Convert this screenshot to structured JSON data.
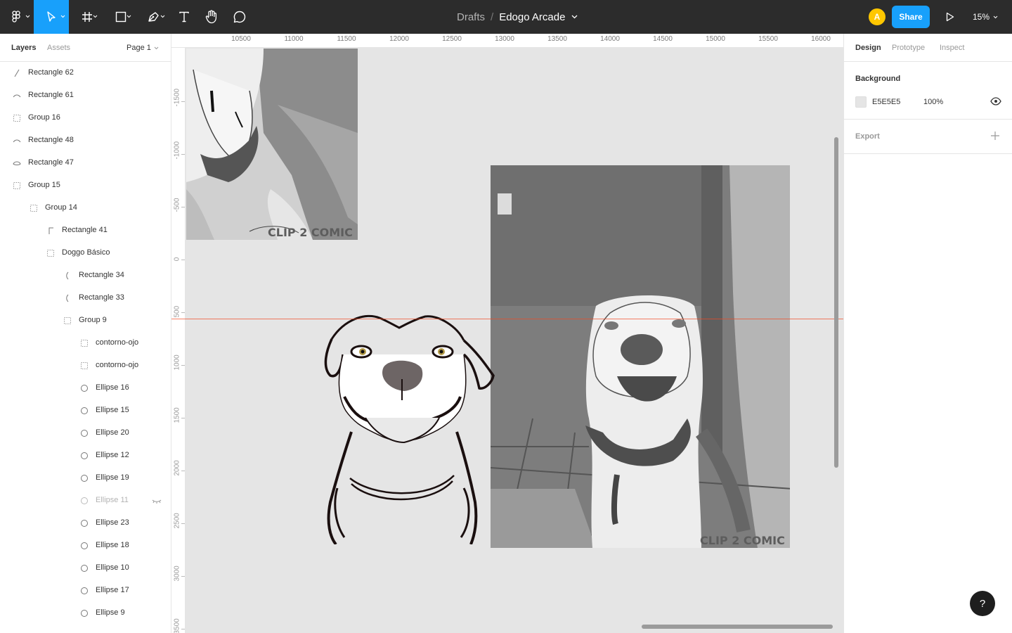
{
  "toolbar": {
    "tools": [
      {
        "icon": "figma-menu-icon"
      },
      {
        "icon": "move-tool-icon",
        "active": true
      },
      {
        "icon": "frame-tool-icon"
      },
      {
        "icon": "rectangle-tool-icon"
      },
      {
        "icon": "pen-tool-icon"
      },
      {
        "icon": "text-tool-icon"
      },
      {
        "icon": "hand-tool-icon"
      },
      {
        "icon": "comment-tool-icon"
      }
    ],
    "breadcrumb": "Drafts",
    "separator": "/",
    "file_name": "Edogo Arcade",
    "avatar_initial": "A",
    "share_label": "Share",
    "zoom": "15%",
    "accent_color": "#18a0fb"
  },
  "left_panel": {
    "tabs": [
      "Layers",
      "Assets"
    ],
    "page": "Page 1",
    "layers": [
      {
        "name": "Rectangle 62",
        "icon": "vector-line-icon",
        "depth": 0
      },
      {
        "name": "Rectangle 61",
        "icon": "vector-curve-icon",
        "depth": 0
      },
      {
        "name": "Group 16",
        "icon": "group-icon",
        "depth": 0
      },
      {
        "name": "Rectangle 48",
        "icon": "vector-curve-icon",
        "depth": 0
      },
      {
        "name": "Rectangle 47",
        "icon": "vector-shape-icon",
        "depth": 0
      },
      {
        "name": "Group 15",
        "icon": "group-icon",
        "depth": 0
      },
      {
        "name": "Group 14",
        "icon": "group-icon",
        "depth": 1
      },
      {
        "name": "Rectangle 41",
        "icon": "vector-corner-icon",
        "depth": 2
      },
      {
        "name": "Doggo Básico",
        "icon": "group-icon",
        "depth": 2
      },
      {
        "name": "Rectangle 34",
        "icon": "vector-paren-icon",
        "depth": 3
      },
      {
        "name": "Rectangle 33",
        "icon": "vector-paren-icon",
        "depth": 3
      },
      {
        "name": "Group 9",
        "icon": "group-icon",
        "depth": 3
      },
      {
        "name": "contorno-ojo",
        "icon": "group-icon",
        "depth": 4
      },
      {
        "name": "contorno-ojo",
        "icon": "group-icon",
        "depth": 4
      },
      {
        "name": "Ellipse 16",
        "icon": "ellipse-icon",
        "depth": 4
      },
      {
        "name": "Ellipse 15",
        "icon": "ellipse-icon",
        "depth": 4
      },
      {
        "name": "Ellipse 20",
        "icon": "ellipse-icon",
        "depth": 4
      },
      {
        "name": "Ellipse 12",
        "icon": "ellipse-icon",
        "depth": 4
      },
      {
        "name": "Ellipse 19",
        "icon": "ellipse-icon",
        "depth": 4
      },
      {
        "name": "Ellipse 11",
        "icon": "ellipse-icon",
        "depth": 4,
        "hidden": true
      },
      {
        "name": "Ellipse 23",
        "icon": "ellipse-icon",
        "depth": 4
      },
      {
        "name": "Ellipse 18",
        "icon": "ellipse-icon",
        "depth": 4
      },
      {
        "name": "Ellipse 10",
        "icon": "ellipse-icon",
        "depth": 4
      },
      {
        "name": "Ellipse 17",
        "icon": "ellipse-icon",
        "depth": 4
      },
      {
        "name": "Ellipse 9",
        "icon": "ellipse-icon",
        "depth": 4
      }
    ]
  },
  "rulers": {
    "top": [
      "10500",
      "11000",
      "11500",
      "12000",
      "12500",
      "13000",
      "13500",
      "14000",
      "14500",
      "15000",
      "15500",
      "16000"
    ],
    "left": [
      "-1500",
      "-1000",
      "-500",
      "0",
      "500",
      "1000",
      "1500",
      "2000",
      "2500",
      "3000",
      "3500"
    ]
  },
  "canvas": {
    "background": "#e5e5e5",
    "watermark": "CLIP 2 COMIC"
  },
  "right_panel": {
    "tabs": [
      "Design",
      "Prototype",
      "Inspect"
    ],
    "background_title": "Background",
    "background_hex": "E5E5E5",
    "background_opacity": "100%",
    "export_title": "Export"
  },
  "help_label": "?"
}
